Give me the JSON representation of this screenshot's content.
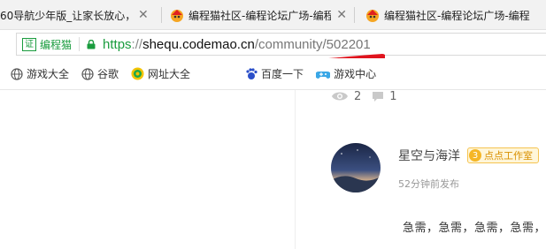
{
  "tabs": [
    {
      "title": "60导航少年版_让家长放心，",
      "close": "✕"
    },
    {
      "title": "编程猫社区-编程论坛广场-编程",
      "close": "✕"
    },
    {
      "title": "编程猫社区-编程论坛广场-编程",
      "close": ""
    }
  ],
  "address_bar": {
    "cert_badge": "证",
    "cert_name": "编程猫",
    "url_scheme": "https",
    "url_sep": "://",
    "url_host": "shequ.codemao.cn",
    "url_path": "/community/502201"
  },
  "bookmarks": [
    {
      "label": "游戏大全",
      "icon": "globe-icon"
    },
    {
      "label": "谷歌",
      "icon": "globe-icon"
    },
    {
      "label": "网址大全",
      "icon": "360-icon"
    },
    {
      "label": "百度一下",
      "icon": "baidu-icon"
    },
    {
      "label": "游戏中心",
      "icon": "game-center-icon"
    }
  ],
  "post_stats": {
    "views": "2",
    "comments": "1"
  },
  "post": {
    "author": "星空与海洋",
    "badge_level": "3",
    "badge_text": "点点工作室",
    "time": "52分钟前发布",
    "content": "急需，急需，急需，急需，"
  },
  "colors": {
    "secure_green": "#1a9c3e",
    "badge_orange": "#f5b626",
    "redaction_red": "#e0141e"
  }
}
